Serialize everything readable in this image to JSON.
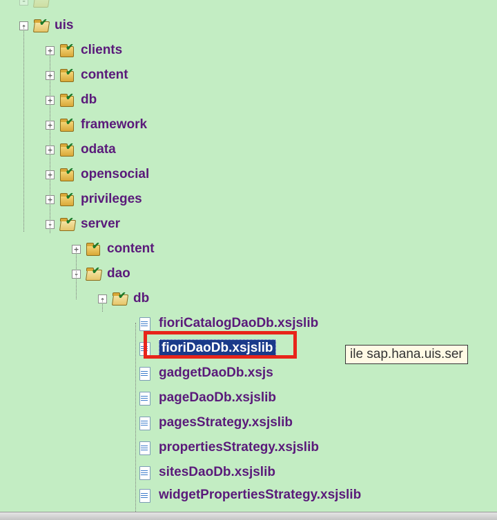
{
  "tree": {
    "truncated_top": "…",
    "uis": {
      "label": "uis",
      "children": {
        "clients": "clients",
        "content": "content",
        "db": "db",
        "framework": "framework",
        "odata": "odata",
        "opensocial": "opensocial",
        "privileges": "privileges",
        "server": {
          "label": "server",
          "children": {
            "content": "content",
            "dao": {
              "label": "dao",
              "db": {
                "label": "db",
                "files": [
                  "fioriCatalogDaoDb.xsjslib",
                  "fioriDaoDb.xsjslib",
                  "gadgetDaoDb.xsjs",
                  "pageDaoDb.xsjslib",
                  "pagesStrategy.xsjslib",
                  "propertiesStrategy.xsjslib",
                  "sitesDaoDb.xsjslib",
                  "widgetPropertiesStrategy.xsjslib"
                ]
              }
            }
          }
        }
      }
    }
  },
  "selected_file": "fioriDaoDb.xsjslib",
  "tooltip_text": "ile sap.hana.uis.ser",
  "expander": {
    "plus": "+",
    "minus": "-"
  }
}
